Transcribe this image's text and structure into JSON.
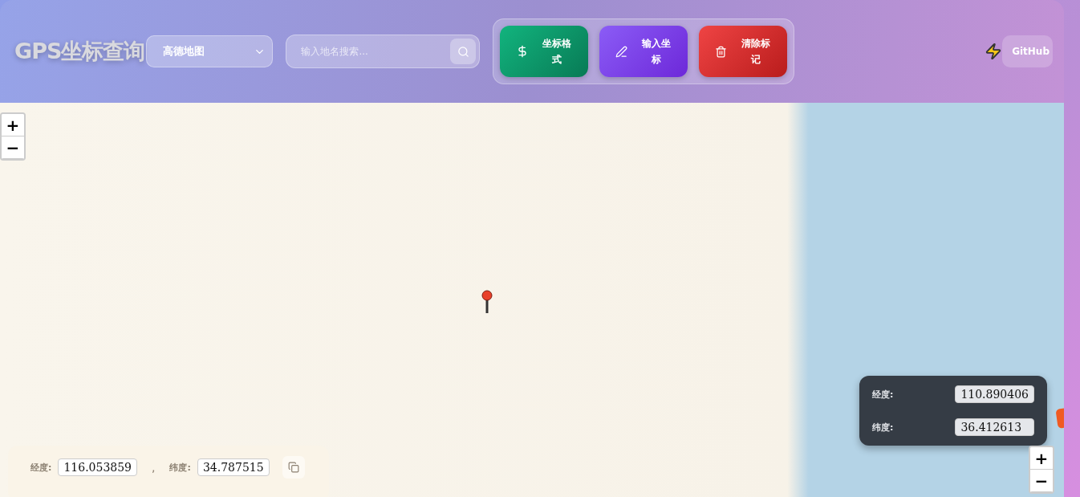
{
  "header": {
    "title": "GPS坐标查询",
    "map_select": {
      "value": "高德地图"
    },
    "search": {
      "placeholder": "输入地名搜索..."
    },
    "actions": [
      {
        "kind": "format",
        "label": "坐标格式"
      },
      {
        "kind": "input",
        "label": "输入坐标"
      },
      {
        "kind": "clear",
        "label": "清除标记"
      }
    ],
    "github": "GitHub"
  },
  "map": {
    "zoom_top": [
      "+",
      "−"
    ],
    "zoom_bottom": [
      "+",
      "−"
    ],
    "coords_panel": {
      "lng_label": "经度:",
      "lng": "116.053859",
      "separator": ",",
      "lat_label": "纬度:",
      "lat": "34.787515"
    },
    "hover_panel": {
      "lng_label": "经度:",
      "lng": "110.890406",
      "lat_label": "纬度:",
      "lat": "36.412613"
    }
  }
}
